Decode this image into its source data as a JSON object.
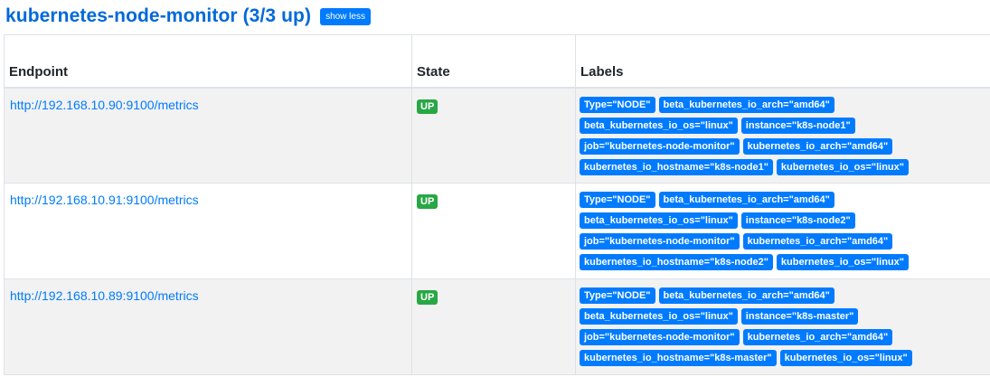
{
  "job": {
    "title": "kubernetes-node-monitor (3/3 up)",
    "toggle_label": "show less"
  },
  "table": {
    "headers": {
      "endpoint": "Endpoint",
      "state": "State",
      "labels": "Labels"
    },
    "rows": [
      {
        "endpoint": "http://192.168.10.90:9100/metrics",
        "state": "UP",
        "labels": [
          [
            "Type=\"NODE\"",
            "beta_kubernetes_io_arch=\"amd64\""
          ],
          [
            "beta_kubernetes_io_os=\"linux\"",
            "instance=\"k8s-node1\""
          ],
          [
            "job=\"kubernetes-node-monitor\"",
            "kubernetes_io_arch=\"amd64\""
          ],
          [
            "kubernetes_io_hostname=\"k8s-node1\"",
            "kubernetes_io_os=\"linux\""
          ]
        ]
      },
      {
        "endpoint": "http://192.168.10.91:9100/metrics",
        "state": "UP",
        "labels": [
          [
            "Type=\"NODE\"",
            "beta_kubernetes_io_arch=\"amd64\""
          ],
          [
            "beta_kubernetes_io_os=\"linux\"",
            "instance=\"k8s-node2\""
          ],
          [
            "job=\"kubernetes-node-monitor\"",
            "kubernetes_io_arch=\"amd64\""
          ],
          [
            "kubernetes_io_hostname=\"k8s-node2\"",
            "kubernetes_io_os=\"linux\""
          ]
        ]
      },
      {
        "endpoint": "http://192.168.10.89:9100/metrics",
        "state": "UP",
        "labels": [
          [
            "Type=\"NODE\"",
            "beta_kubernetes_io_arch=\"amd64\""
          ],
          [
            "beta_kubernetes_io_os=\"linux\"",
            "instance=\"k8s-master\""
          ],
          [
            "job=\"kubernetes-node-monitor\"",
            "kubernetes_io_arch=\"amd64\""
          ],
          [
            "kubernetes_io_hostname=\"k8s-master\"",
            "kubernetes_io_os=\"linux\""
          ]
        ]
      }
    ]
  },
  "colors": {
    "title": "#0069d9",
    "link": "#007bff",
    "label_badge": "#007bff",
    "up_badge": "#28a745",
    "row_stripe": "#f2f2f2"
  }
}
